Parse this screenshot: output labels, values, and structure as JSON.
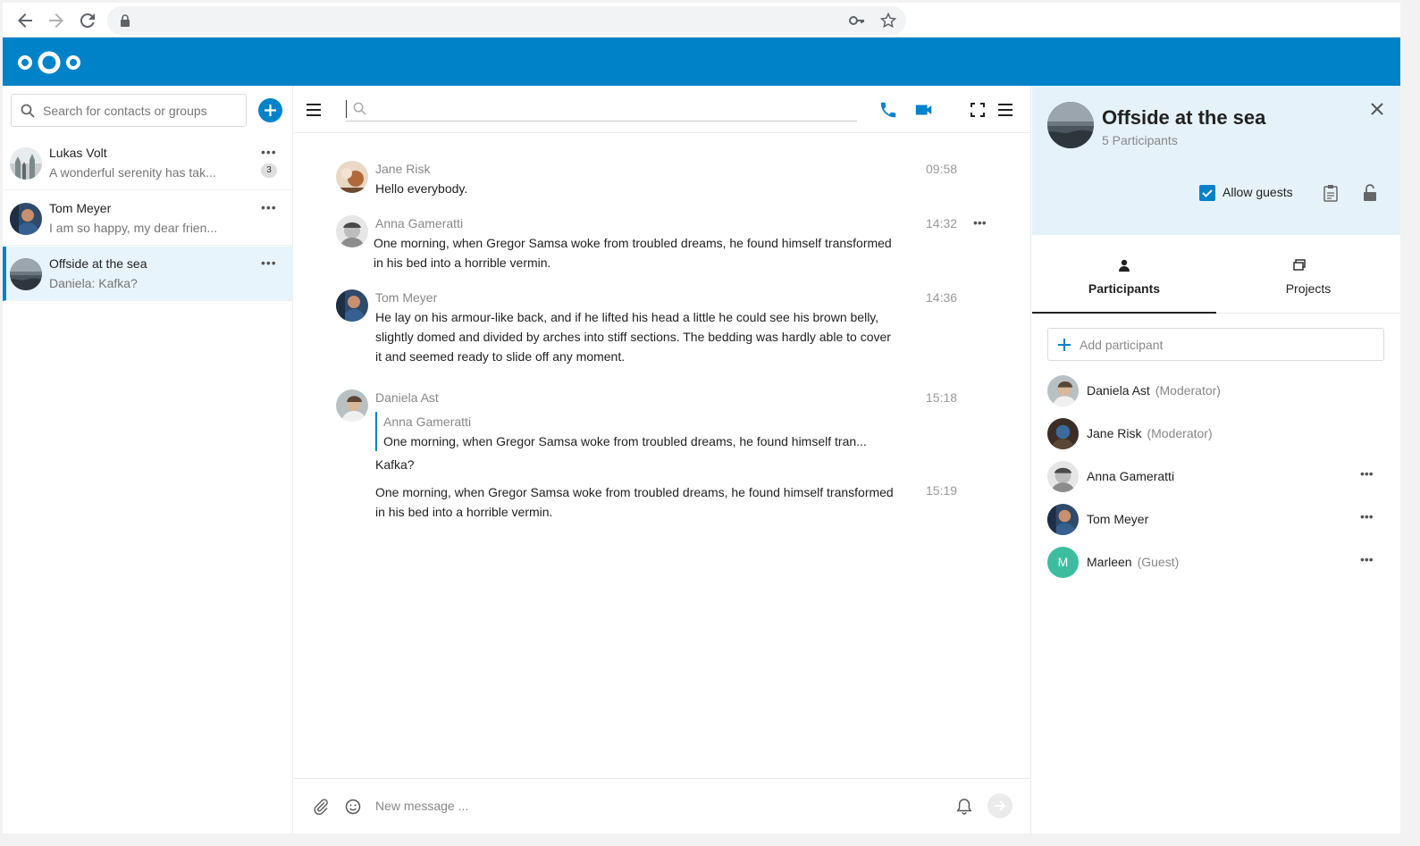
{
  "browser": {
    "url": ""
  },
  "colors": {
    "brand": "#0082c9",
    "guest_avatar": "#3dbd9e"
  },
  "sidebar": {
    "search_placeholder": "Search for contacts or groups",
    "conversations": [
      {
        "name": "Lukas Volt",
        "last_message": "A wonderful serenity has tak...",
        "unread": "3",
        "active": false
      },
      {
        "name": "Tom Meyer",
        "last_message": "I am so happy, my dear frien...",
        "unread": "",
        "active": false
      },
      {
        "name": "Offside at the sea",
        "last_message": "Daniela: Kafka?",
        "unread": "",
        "active": true
      }
    ]
  },
  "chat": {
    "messages": [
      {
        "author": "Jane Risk",
        "time": "09:58",
        "text": "Hello everybody."
      },
      {
        "author": "Anna Gameratti",
        "time": "14:32",
        "text_line1": "One morning, when Gregor Samsa woke from troubled dreams, he found himself transformed",
        "text_line2": "in his bed into a horrible vermin."
      },
      {
        "author": "Tom Meyer",
        "time": "14:36",
        "text_line1": "He lay on his armour-like back, and if he lifted his head a little he could see his brown belly,",
        "text_line2": "slightly domed and divided by arches into stiff sections. The bedding was hardly able to cover",
        "text_line3": "it and seemed ready to slide off any moment."
      },
      {
        "author": "Daniela Ast",
        "time": "15:18",
        "quote_author": "Anna Gameratti",
        "quote_text": "One morning, when Gregor Samsa woke from troubled dreams, he found himself tran...",
        "text": "Kafka?"
      },
      {
        "time": "15:19",
        "text_line1": "One morning, when Gregor Samsa woke from troubled dreams, he found himself transformed",
        "text_line2": "in his bed into a horrible vermin."
      }
    ],
    "composer_placeholder": "New message ..."
  },
  "details": {
    "title": "Offside at the sea",
    "subtitle": "5 Participants",
    "allow_guests_label": "Allow guests",
    "allow_guests_checked": true,
    "tabs": [
      {
        "label": "Participants",
        "active": true
      },
      {
        "label": "Projects",
        "active": false
      }
    ],
    "add_participant_placeholder": "Add participant",
    "participants": [
      {
        "name": "Daniela Ast",
        "role": "(Moderator)"
      },
      {
        "name": "Jane Risk",
        "role": "(Moderator)"
      },
      {
        "name": "Anna Gameratti",
        "role": ""
      },
      {
        "name": "Tom Meyer",
        "role": ""
      },
      {
        "name": "Marleen",
        "role": "(Guest)",
        "initial": "M"
      }
    ]
  },
  "icons": [
    "back-icon",
    "forward-icon",
    "reload-icon",
    "lock-icon",
    "key-icon",
    "star-icon",
    "nextcloud-logo",
    "search-icon",
    "plus-icon",
    "more-icon",
    "menu-icon",
    "phone-icon",
    "video-icon",
    "fullscreen-icon",
    "attachment-icon",
    "emoji-icon",
    "bell-icon",
    "send-icon",
    "close-icon",
    "clipboard-icon",
    "lock-open-icon",
    "participants-icon",
    "projects-icon"
  ]
}
